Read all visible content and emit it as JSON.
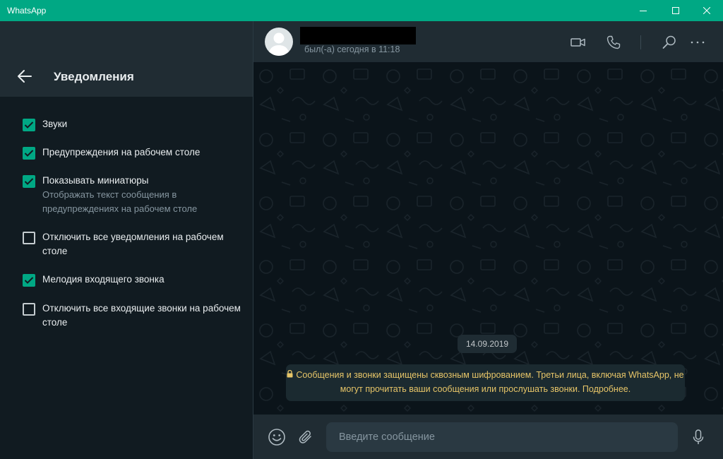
{
  "window": {
    "title": "WhatsApp"
  },
  "settings": {
    "title": "Уведомления",
    "options": [
      {
        "label": "Звуки",
        "checked": true
      },
      {
        "label": "Предупреждения на рабочем столе",
        "checked": true
      },
      {
        "label": "Показывать миниатюры",
        "sublabel": "Отображать текст сообщения в предупреждениях на рабочем столе",
        "checked": true
      },
      {
        "label": "Отключить все уведомления на рабочем столе",
        "checked": false
      },
      {
        "label": "Мелодия входящего звонка",
        "checked": true
      },
      {
        "label": "Отключить все входящие звонки на рабочем столе",
        "checked": false
      }
    ]
  },
  "chat": {
    "last_seen": "был(-а) сегодня в 11:18",
    "date": "14.09.2019",
    "encryption_notice": "Сообщения и звонки защищены сквозным шифрованием. Третьи лица, включая WhatsApp, не могут прочитать ваши сообщения или прослушать звонки. Подробнее."
  },
  "composer": {
    "placeholder": "Введите сообщение"
  },
  "icons": [
    "back-arrow-icon",
    "video-call-icon",
    "voice-call-icon",
    "search-icon",
    "more-options-icon",
    "emoji-icon",
    "attach-icon",
    "microphone-icon",
    "lock-icon",
    "checkmark-icon"
  ],
  "colors": {
    "accent": "#00a884",
    "panel": "#111b21",
    "header": "#202c33",
    "notice_text": "#e7c568"
  }
}
